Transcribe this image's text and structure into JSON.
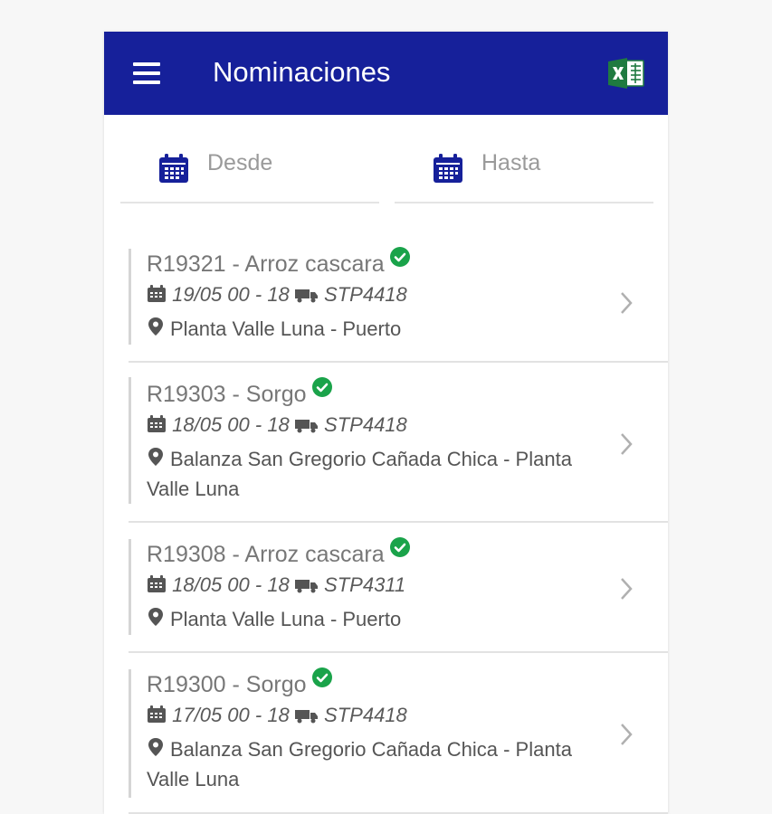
{
  "app": {
    "title": "Nominaciones",
    "accent_color": "#16209a",
    "icons": {
      "menu": "hamburger-menu-icon",
      "export": "excel-icon"
    }
  },
  "filters": {
    "from": {
      "placeholder": "Desde",
      "value": "",
      "icon": "calendar-icon"
    },
    "to": {
      "placeholder": "Hasta",
      "value": "",
      "icon": "calendar-icon"
    }
  },
  "nominations": [
    {
      "title": "R19321 - Arroz cascara",
      "status": "check-circle-icon",
      "datetime": "19/05 00 - 18",
      "plate": "STP4418",
      "route": "Planta Valle Luna - Puerto"
    },
    {
      "title": "R19303 - Sorgo",
      "status": "check-circle-icon",
      "datetime": "18/05 00 - 18",
      "plate": "STP4418",
      "route": "Balanza San Gregorio Cañada Chica - Planta Valle Luna"
    },
    {
      "title": "R19308 - Arroz cascara",
      "status": "check-circle-icon",
      "datetime": "18/05 00 - 18",
      "plate": "STP4311",
      "route": "Planta Valle Luna - Puerto"
    },
    {
      "title": "R19300 - Sorgo",
      "status": "check-circle-icon",
      "datetime": "17/05 00 - 18",
      "plate": "STP4418",
      "route": "Balanza San Gregorio Cañada Chica - Planta Valle Luna"
    }
  ]
}
